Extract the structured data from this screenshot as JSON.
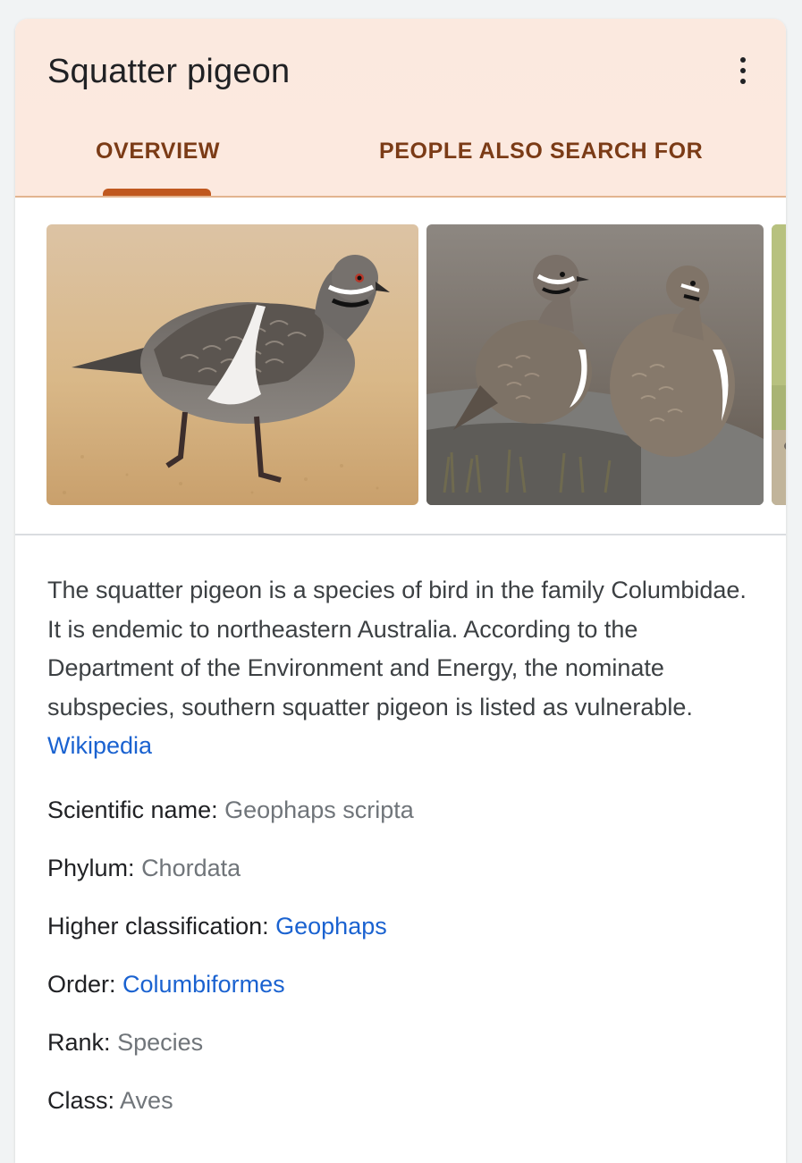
{
  "title": "Squatter pigeon",
  "menu_icon": "more-vert-icon",
  "tabs": [
    {
      "label": "OVERVIEW",
      "active": true
    },
    {
      "label": "PEOPLE ALSO SEARCH FOR",
      "active": false
    }
  ],
  "accent_color": "#c0581f",
  "tab_text_color": "#7b3b16",
  "link_color": "#1a62d0",
  "description": {
    "text": "The squatter pigeon is a species of bird in the family Columbidae. It is endemic to northeastern Australia. According to the Department of the Environment and Energy, the nominate subspecies, southern squatter pigeon is listed as vulnerable.",
    "source_link": "Wikipedia"
  },
  "facts": [
    {
      "label": "Scientific name:",
      "value": "Geophaps scripta",
      "is_link": false
    },
    {
      "label": "Phylum:",
      "value": "Chordata",
      "is_link": false
    },
    {
      "label": "Higher classification:",
      "value": "Geophaps",
      "is_link": true
    },
    {
      "label": "Order:",
      "value": "Columbiformes",
      "is_link": true
    },
    {
      "label": "Rank:",
      "value": "Species",
      "is_link": false
    },
    {
      "label": "Class:",
      "value": "Aves",
      "is_link": false
    }
  ]
}
